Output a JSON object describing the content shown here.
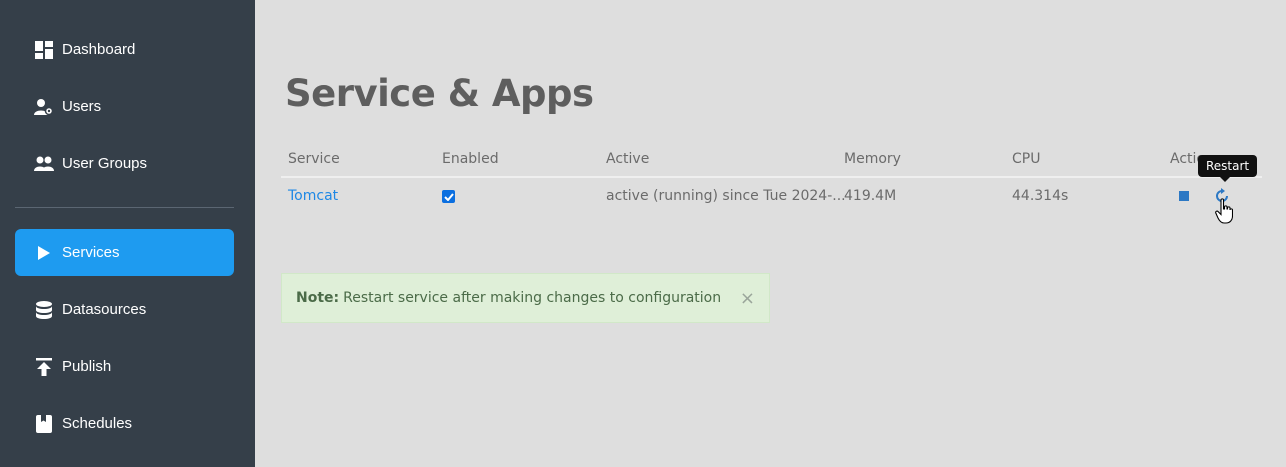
{
  "sidebar": {
    "items": [
      {
        "label": "Dashboard",
        "icon": "dashboard-icon"
      },
      {
        "label": "Users",
        "icon": "user-gear-icon"
      },
      {
        "label": "User Groups",
        "icon": "user-group-icon"
      },
      {
        "label": "Services",
        "icon": "play-icon",
        "active": true
      },
      {
        "label": "Datasources",
        "icon": "database-icon"
      },
      {
        "label": "Publish",
        "icon": "upload-icon"
      },
      {
        "label": "Schedules",
        "icon": "book-icon"
      }
    ]
  },
  "main": {
    "title": "Service & Apps",
    "table": {
      "headers": [
        "Service",
        "Enabled",
        "Active",
        "Memory",
        "CPU",
        "Actio"
      ],
      "rows": [
        {
          "service": "Tomcat",
          "enabled": true,
          "active": "active (running) since Tue 2024-...",
          "memory": "419.4M",
          "cpu": "44.314s"
        }
      ]
    },
    "tooltip": "Restart",
    "alert": {
      "prefix": "Note:",
      "text": "Restart service after making changes to configuration",
      "close": "×"
    }
  },
  "colors": {
    "sidebar": "#353f49",
    "accent": "#1e9bf0",
    "background": "#dedede",
    "alert_bg": "#dfefd8"
  }
}
